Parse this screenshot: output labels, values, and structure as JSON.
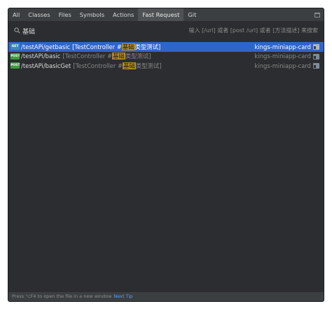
{
  "tabs": [
    {
      "label": "All"
    },
    {
      "label": "Classes"
    },
    {
      "label": "Files"
    },
    {
      "label": "Symbols"
    },
    {
      "label": "Actions"
    },
    {
      "label": "Fast Request",
      "active": true
    },
    {
      "label": "Git"
    }
  ],
  "search": {
    "value": "基础",
    "hint": "输入 [/url] 或者 [post /url] 或者 [方法描述] 来搜索"
  },
  "results": [
    {
      "method": "GET",
      "method_color": "#3c8ab6",
      "url": "/testAPi/getbasic",
      "desc_pre": "[TestController #",
      "desc_hl": "基础",
      "desc_post": "类型测试]",
      "module": "kings-miniapp-card",
      "selected": true
    },
    {
      "method": "POST",
      "method_color": "#3c9a3c",
      "url": "/testAPi/basic",
      "desc_pre": "[TestController #",
      "desc_hl": "基础",
      "desc_post": "类型测试]",
      "module": "kings-miniapp-card",
      "selected": false
    },
    {
      "method": "POST",
      "method_color": "#3c9a3c",
      "url": "/testAPi/basicGet",
      "desc_pre": "[TestController #",
      "desc_hl": "基础",
      "desc_post": "类型测试]",
      "module": "kings-miniapp-card",
      "selected": false
    }
  ],
  "footer": {
    "text": "Press ⌥F4 to open the file in a new window",
    "link": "Next Tip"
  },
  "colors": {
    "selection": "#2f65ca",
    "highlight": "#b58b2b",
    "link": "#589df6"
  },
  "icons": [
    "search-icon",
    "window-icon",
    "module-icon"
  ]
}
